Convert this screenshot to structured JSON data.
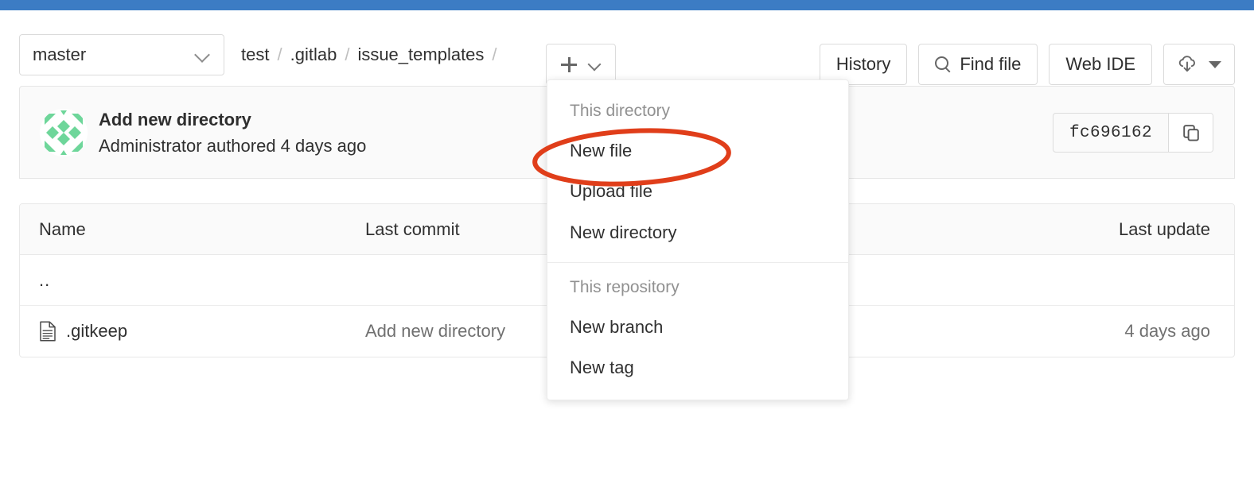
{
  "theme": {
    "top_bar_color": "#3c7cc4",
    "annotation_color": "#e03e1a",
    "avatar_color": "#6ed69a"
  },
  "toolbar": {
    "branch_selector": {
      "value": "master",
      "icon": "chevron-down-icon"
    },
    "breadcrumb": [
      {
        "label": "test"
      },
      {
        "label": ".gitlab"
      },
      {
        "label": "issue_templates"
      }
    ],
    "breadcrumb_separator": "/",
    "add_button": {
      "plus_icon": "plus-icon",
      "chevron_icon": "chevron-down-icon"
    },
    "actions": [
      {
        "label": "History",
        "icon": null,
        "name": "history-button"
      },
      {
        "label": "Find file",
        "icon": "search-icon",
        "name": "find-file-button"
      },
      {
        "label": "Web IDE",
        "icon": null,
        "name": "web-ide-button"
      }
    ],
    "download_button": {
      "icon": "cloud-download-icon",
      "caret": "caret-down-icon"
    }
  },
  "commit": {
    "avatar_icon": "identicon-avatar",
    "title": "Add new directory",
    "author": "Administrator",
    "meta_suffix": "authored 4 days ago",
    "sha": "fc696162",
    "copy_icon": "copy-icon"
  },
  "file_table": {
    "columns": {
      "name": "Name",
      "last_commit": "Last commit",
      "last_update": "Last update"
    },
    "rows": [
      {
        "name": "..",
        "is_parent": true,
        "icon": null,
        "last_commit": "",
        "last_update": ""
      },
      {
        "name": ".gitkeep",
        "is_parent": false,
        "icon": "file-icon",
        "last_commit": "Add new directory",
        "last_update": "4 days ago"
      }
    ]
  },
  "dropdown": {
    "sections": [
      {
        "header": "This directory",
        "items": [
          {
            "label": "New file",
            "highlighted": true
          },
          {
            "label": "Upload file",
            "highlighted": false
          },
          {
            "label": "New directory",
            "highlighted": false
          }
        ]
      },
      {
        "header": "This repository",
        "items": [
          {
            "label": "New branch",
            "highlighted": false
          },
          {
            "label": "New tag",
            "highlighted": false
          }
        ]
      }
    ]
  },
  "annotation": {
    "shape": "ellipse",
    "target": "New file"
  }
}
